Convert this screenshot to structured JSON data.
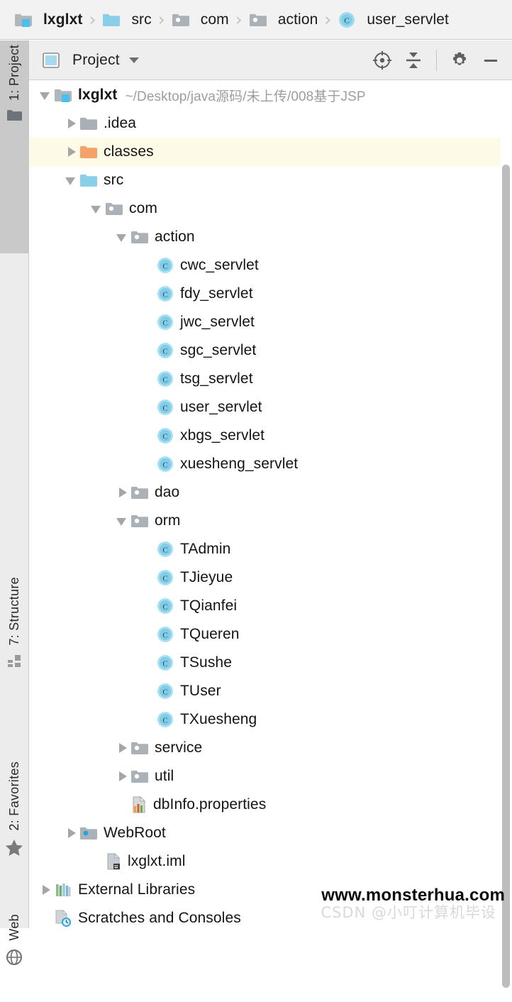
{
  "breadcrumb": {
    "separator": "›",
    "items": [
      {
        "label": "lxglxt",
        "icon": "module-folder-icon",
        "bold": true
      },
      {
        "label": "src",
        "icon": "source-folder-icon",
        "bold": false
      },
      {
        "label": "com",
        "icon": "package-folder-icon",
        "bold": false
      },
      {
        "label": "action",
        "icon": "package-folder-icon",
        "bold": false
      },
      {
        "label": "user_servlet",
        "icon": "java-class-icon",
        "bold": false
      }
    ]
  },
  "tool_window": {
    "title": "Project",
    "view_icon": "project-view-icon",
    "dropdown_icon": "chevron-down-icon",
    "actions": [
      {
        "name": "select-opened-file-button",
        "icon": "crosshair-target-icon"
      },
      {
        "name": "collapse-all-button",
        "icon": "collapse-all-icon"
      },
      {
        "name": "settings-button",
        "icon": "gear-icon"
      },
      {
        "name": "hide-button",
        "icon": "minimize-icon"
      }
    ]
  },
  "tool_stripe": {
    "tabs": [
      {
        "label": "1: Project",
        "mnemonic": "1",
        "icon": "project-folder-icon",
        "active": true
      },
      {
        "label": "7: Structure",
        "mnemonic": "7",
        "icon": "structure-blocks-icon",
        "active": false
      },
      {
        "label": "2: Favorites",
        "mnemonic": "2",
        "icon": "star-icon",
        "active": false
      },
      {
        "label": "Web",
        "mnemonic": "",
        "icon": "globe-icon",
        "active": false
      }
    ]
  },
  "tree": {
    "rows": [
      {
        "label": "lxglxt",
        "sub": "~/Desktop/java源码/未上传/008基于JSP",
        "indent": 0,
        "arrow": "open",
        "icon": "module-folder-icon",
        "bold": true,
        "highlight": false
      },
      {
        "label": ".idea",
        "sub": "",
        "indent": 1,
        "arrow": "closed",
        "icon": "folder-icon",
        "bold": false,
        "highlight": false
      },
      {
        "label": "classes",
        "sub": "",
        "indent": 1,
        "arrow": "closed",
        "icon": "excluded-folder-icon",
        "bold": false,
        "highlight": true
      },
      {
        "label": "src",
        "sub": "",
        "indent": 1,
        "arrow": "open",
        "icon": "source-folder-icon",
        "bold": false,
        "highlight": false
      },
      {
        "label": "com",
        "sub": "",
        "indent": 2,
        "arrow": "open",
        "icon": "package-folder-icon",
        "bold": false,
        "highlight": false
      },
      {
        "label": "action",
        "sub": "",
        "indent": 3,
        "arrow": "open",
        "icon": "package-folder-icon",
        "bold": false,
        "highlight": false
      },
      {
        "label": "cwc_servlet",
        "sub": "",
        "indent": 4,
        "arrow": "none",
        "icon": "java-class-icon",
        "bold": false,
        "highlight": false
      },
      {
        "label": "fdy_servlet",
        "sub": "",
        "indent": 4,
        "arrow": "none",
        "icon": "java-class-icon",
        "bold": false,
        "highlight": false
      },
      {
        "label": "jwc_servlet",
        "sub": "",
        "indent": 4,
        "arrow": "none",
        "icon": "java-class-icon",
        "bold": false,
        "highlight": false
      },
      {
        "label": "sgc_servlet",
        "sub": "",
        "indent": 4,
        "arrow": "none",
        "icon": "java-class-icon",
        "bold": false,
        "highlight": false
      },
      {
        "label": "tsg_servlet",
        "sub": "",
        "indent": 4,
        "arrow": "none",
        "icon": "java-class-icon",
        "bold": false,
        "highlight": false
      },
      {
        "label": "user_servlet",
        "sub": "",
        "indent": 4,
        "arrow": "none",
        "icon": "java-class-icon",
        "bold": false,
        "highlight": false
      },
      {
        "label": "xbgs_servlet",
        "sub": "",
        "indent": 4,
        "arrow": "none",
        "icon": "java-class-icon",
        "bold": false,
        "highlight": false
      },
      {
        "label": "xuesheng_servlet",
        "sub": "",
        "indent": 4,
        "arrow": "none",
        "icon": "java-class-icon",
        "bold": false,
        "highlight": false
      },
      {
        "label": "dao",
        "sub": "",
        "indent": 3,
        "arrow": "closed",
        "icon": "package-folder-icon",
        "bold": false,
        "highlight": false
      },
      {
        "label": "orm",
        "sub": "",
        "indent": 3,
        "arrow": "open",
        "icon": "package-folder-icon",
        "bold": false,
        "highlight": false
      },
      {
        "label": "TAdmin",
        "sub": "",
        "indent": 4,
        "arrow": "none",
        "icon": "java-class-icon",
        "bold": false,
        "highlight": false
      },
      {
        "label": "TJieyue",
        "sub": "",
        "indent": 4,
        "arrow": "none",
        "icon": "java-class-icon",
        "bold": false,
        "highlight": false
      },
      {
        "label": "TQianfei",
        "sub": "",
        "indent": 4,
        "arrow": "none",
        "icon": "java-class-icon",
        "bold": false,
        "highlight": false
      },
      {
        "label": "TQueren",
        "sub": "",
        "indent": 4,
        "arrow": "none",
        "icon": "java-class-icon",
        "bold": false,
        "highlight": false
      },
      {
        "label": "TSushe",
        "sub": "",
        "indent": 4,
        "arrow": "none",
        "icon": "java-class-icon",
        "bold": false,
        "highlight": false
      },
      {
        "label": "TUser",
        "sub": "",
        "indent": 4,
        "arrow": "none",
        "icon": "java-class-icon",
        "bold": false,
        "highlight": false
      },
      {
        "label": "TXuesheng",
        "sub": "",
        "indent": 4,
        "arrow": "none",
        "icon": "java-class-icon",
        "bold": false,
        "highlight": false
      },
      {
        "label": "service",
        "sub": "",
        "indent": 3,
        "arrow": "closed",
        "icon": "package-folder-icon",
        "bold": false,
        "highlight": false
      },
      {
        "label": "util",
        "sub": "",
        "indent": 3,
        "arrow": "closed",
        "icon": "package-folder-icon",
        "bold": false,
        "highlight": false
      },
      {
        "label": "dbInfo.properties",
        "sub": "",
        "indent": 3,
        "arrow": "none",
        "icon": "properties-file-icon",
        "bold": false,
        "highlight": false
      },
      {
        "label": "WebRoot",
        "sub": "",
        "indent": 1,
        "arrow": "closed",
        "icon": "web-folder-icon",
        "bold": false,
        "highlight": false
      },
      {
        "label": "lxglxt.iml",
        "sub": "",
        "indent": 2,
        "arrow": "none",
        "icon": "iml-file-icon",
        "bold": false,
        "highlight": false
      },
      {
        "label": "External Libraries",
        "sub": "",
        "indent": 0,
        "arrow": "closed",
        "icon": "libraries-icon",
        "bold": false,
        "highlight": false
      },
      {
        "label": "Scratches and Consoles",
        "sub": "",
        "indent": 0,
        "arrow": "none",
        "icon": "scratches-icon",
        "bold": false,
        "highlight": false
      }
    ]
  },
  "watermarks": {
    "site": "www.monsterhua.com",
    "csdn": "CSDN @小叮计算机毕设"
  },
  "colors": {
    "source_folder": "#89cfe8",
    "excluded_folder": "#f4a26a",
    "class_badge": "#8fd3ec",
    "folder_gray": "#a9b0b5",
    "highlight_row": "#fdfbe8",
    "panel_bg": "#eeeeee",
    "breadcrumb_bg": "#f2f2f2"
  }
}
